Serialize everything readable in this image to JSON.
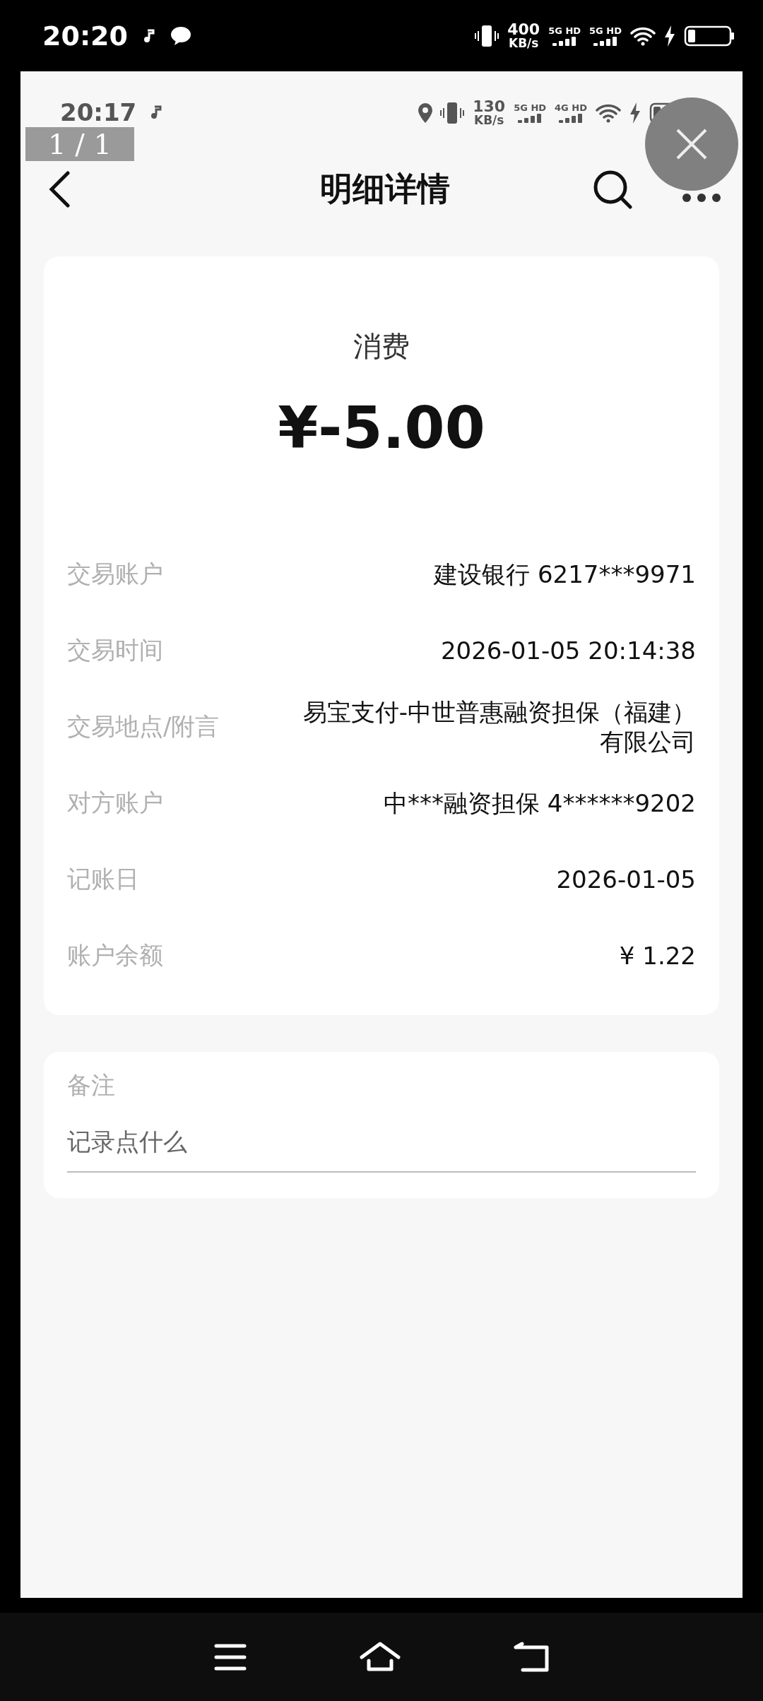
{
  "status_bar": {
    "time": "20:20",
    "speed": "400",
    "speed_unit": "KB/s",
    "networks": [
      "5G HD",
      "5G HD"
    ]
  },
  "viewer": {
    "counter": "1 / 1"
  },
  "inner_status_bar": {
    "time": "20:17",
    "speed": "130",
    "speed_unit": "KB/s",
    "networks": [
      "5G HD",
      "4G HD"
    ]
  },
  "header": {
    "title": "明细详情"
  },
  "summary": {
    "type": "消费",
    "amount": "¥-5.00"
  },
  "details": [
    {
      "label": "交易账户",
      "value": "建设银行 6217***9971"
    },
    {
      "label": "交易时间",
      "value": "2026-01-05 20:14:38"
    },
    {
      "label": "交易地点/附言",
      "value": "易宝支付-中世普惠融资担保（福建）有限公司"
    },
    {
      "label": "对方账户",
      "value": "中***融资担保 4******9202"
    },
    {
      "label": "记账日",
      "value": "2026-01-05"
    },
    {
      "label": "账户余额",
      "value": "¥ 1.22"
    }
  ],
  "note": {
    "label": "备注",
    "placeholder": "记录点什么"
  }
}
